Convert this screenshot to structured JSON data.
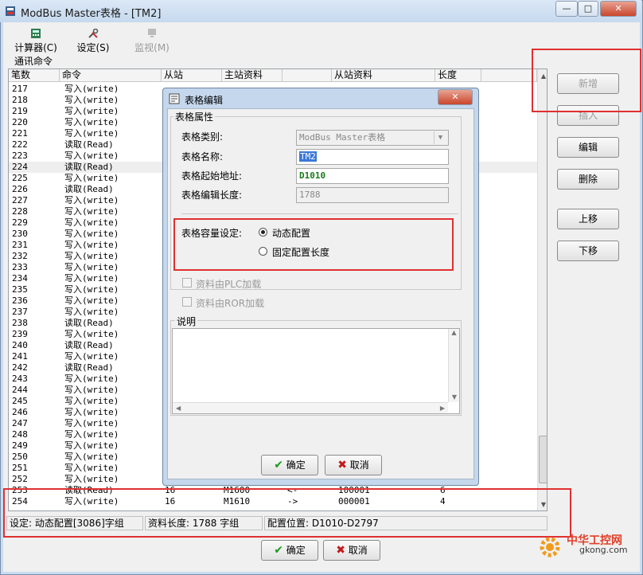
{
  "window": {
    "title": "ModBus Master表格 - [TM2]",
    "minimize": "—",
    "maximize": "□",
    "close": "✕"
  },
  "toolbar": {
    "calculator": "计算器(C)",
    "settings": "设定(S)",
    "monitor": "监视(M)"
  },
  "group_label": "通讯命令",
  "table": {
    "headers": [
      "笔数",
      "命令",
      "从站",
      "主站资料",
      "",
      "从站资料",
      "长度"
    ],
    "rows": [
      {
        "n": "217",
        "cmd": "写入(write)"
      },
      {
        "n": "218",
        "cmd": "写入(write)"
      },
      {
        "n": "219",
        "cmd": "写入(write)"
      },
      {
        "n": "220",
        "cmd": "写入(write)"
      },
      {
        "n": "221",
        "cmd": "写入(write)"
      },
      {
        "n": "222",
        "cmd": "读取(Read)"
      },
      {
        "n": "223",
        "cmd": "写入(write)"
      },
      {
        "n": "224",
        "cmd": "读取(Read)"
      },
      {
        "n": "225",
        "cmd": "写入(write)"
      },
      {
        "n": "226",
        "cmd": "读取(Read)"
      },
      {
        "n": "227",
        "cmd": "写入(write)"
      },
      {
        "n": "228",
        "cmd": "写入(write)"
      },
      {
        "n": "229",
        "cmd": "写入(write)"
      },
      {
        "n": "230",
        "cmd": "写入(write)"
      },
      {
        "n": "231",
        "cmd": "写入(write)"
      },
      {
        "n": "232",
        "cmd": "写入(write)"
      },
      {
        "n": "233",
        "cmd": "写入(write)"
      },
      {
        "n": "234",
        "cmd": "写入(write)"
      },
      {
        "n": "235",
        "cmd": "写入(write)"
      },
      {
        "n": "236",
        "cmd": "写入(write)"
      },
      {
        "n": "237",
        "cmd": "写入(write)"
      },
      {
        "n": "238",
        "cmd": "读取(Read)"
      },
      {
        "n": "239",
        "cmd": "写入(write)"
      },
      {
        "n": "240",
        "cmd": "读取(Read)"
      },
      {
        "n": "241",
        "cmd": "写入(write)"
      },
      {
        "n": "242",
        "cmd": "读取(Read)"
      },
      {
        "n": "243",
        "cmd": "写入(write)"
      },
      {
        "n": "244",
        "cmd": "写入(write)"
      },
      {
        "n": "245",
        "cmd": "写入(write)"
      },
      {
        "n": "246",
        "cmd": "写入(write)"
      },
      {
        "n": "247",
        "cmd": "写入(write)"
      },
      {
        "n": "248",
        "cmd": "写入(write)"
      },
      {
        "n": "249",
        "cmd": "写入(write)"
      },
      {
        "n": "250",
        "cmd": "写入(write)"
      },
      {
        "n": "251",
        "cmd": "写入(write)"
      },
      {
        "n": "252",
        "cmd": "写入(write)"
      },
      {
        "n": "253",
        "cmd": "读取(Read)",
        "slave": "16",
        "master": "M1600",
        "dir": "<-",
        "sdata": "100001",
        "len": "6"
      },
      {
        "n": "254",
        "cmd": "写入(write)",
        "slave": "16",
        "master": "M1610",
        "dir": "->",
        "sdata": "000001",
        "len": "4"
      }
    ]
  },
  "status": {
    "setting": "设定: 动态配置[3086]字组",
    "data_length": "资料长度: 1788 字组",
    "position": "配置位置: D1010-D2797"
  },
  "side_buttons": {
    "add": "新增",
    "insert": "插入",
    "edit": "编辑",
    "delete": "删除",
    "up": "上移",
    "down": "下移"
  },
  "main_ok": "确定",
  "main_cancel": "取消",
  "dialog": {
    "title": "表格编辑",
    "group_props": "表格属性",
    "type_label": "表格类别:",
    "type_value": "ModBus Master表格",
    "name_label": "表格名称:",
    "name_value": "TM2",
    "start_label": "表格起始地址:",
    "start_value": "D1010",
    "length_label": "表格编辑长度:",
    "length_value": "1788",
    "capacity_label": "表格容量设定:",
    "opt_dynamic": "动态配置",
    "opt_fixed": "固定配置长度",
    "plc_load": "资料由PLC加载",
    "ror_load": "资料由ROR加载",
    "desc_label": "说明",
    "ok": "确定",
    "cancel": "取消"
  },
  "watermark": {
    "name": "中华工控网",
    "url": "gkong.com"
  }
}
